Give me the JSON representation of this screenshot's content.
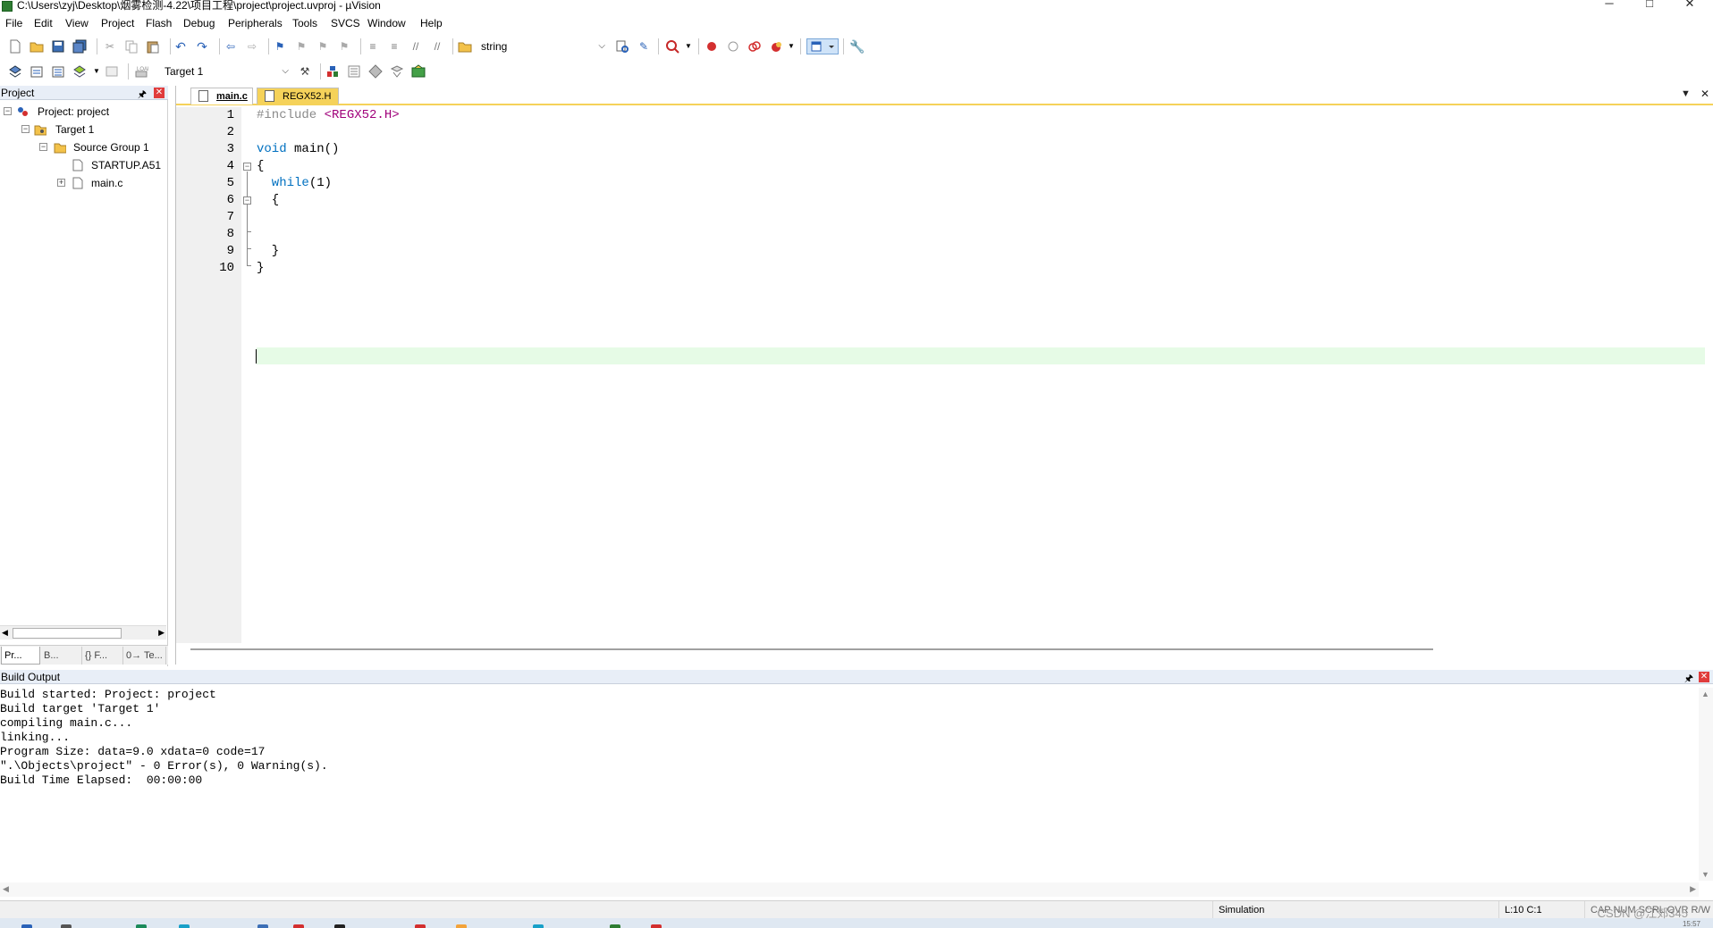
{
  "window": {
    "title": "C:\\Users\\zyj\\Desktop\\烟雾检测-4.22\\项目工程\\project\\project.uvproj - µVision",
    "minimize": "─",
    "maximize": "□",
    "close": "✕"
  },
  "menu": [
    "File",
    "Edit",
    "View",
    "Project",
    "Flash",
    "Debug",
    "Peripherals",
    "Tools",
    "SVCS",
    "Window",
    "Help"
  ],
  "toolbar": {
    "find_combo_value": "string",
    "target_combo_value": "Target 1"
  },
  "project_panel": {
    "title": "Project",
    "tree": {
      "project": "Project: project",
      "target": "Target 1",
      "group": "Source Group 1",
      "files": [
        "STARTUP.A51",
        "main.c"
      ]
    },
    "tabs": [
      "Pr...",
      "B...",
      "{} F...",
      "0→ Te..."
    ]
  },
  "editor": {
    "tabs": [
      "main.c",
      "REGX52.H"
    ],
    "active_tab": "main.c",
    "line_numbers": [
      "1",
      "2",
      "3",
      "4",
      "5",
      "6",
      "7",
      "8",
      "9",
      "10"
    ],
    "code": {
      "l1_directive": "#include",
      "l1_header": " <REGX52.H>",
      "l3_kw": "void",
      "l3_rest": " main()",
      "l4": "{",
      "l5_kw": "  while",
      "l5_rest": "(1)",
      "l6": "  {",
      "l8": "  }",
      "l9": "}"
    },
    "current_line": 10
  },
  "build_output": {
    "title": "Build Output",
    "lines": [
      "Build started: Project: project",
      "Build target 'Target 1'",
      "compiling main.c...",
      "linking...",
      "Program Size: data=9.0 xdata=0 code=17",
      "\".\\Objects\\project\" - 0 Error(s), 0 Warning(s).",
      "Build Time Elapsed:  00:00:00"
    ]
  },
  "status": {
    "mode": "Simulation",
    "position": "L:10 C:1",
    "flags": "CAP  NUM  SCRL  OVR  R/W"
  },
  "watermark": "CSDN @江郊345",
  "clock": "15:57",
  "colors": {
    "keyword": "#0070c0",
    "preprocessor": "#8a8a8a",
    "header_string": "#a0007a",
    "current_line_bg": "#e6fbe6",
    "inactive_tab": "#f5d25a",
    "close_red": "#e03c3c"
  }
}
